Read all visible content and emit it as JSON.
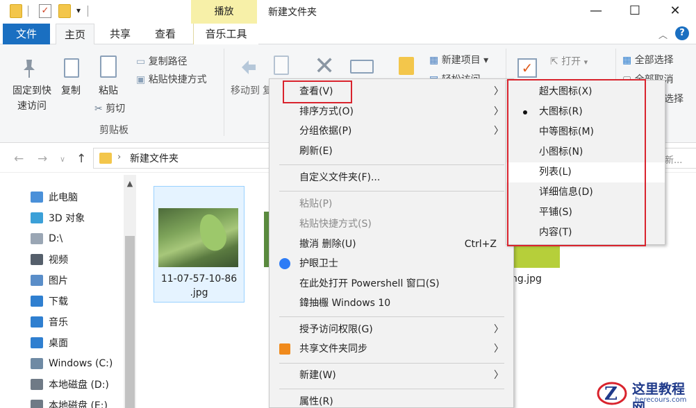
{
  "titlebar": {
    "context_tab": "播放",
    "window_title": "新建文件夹",
    "minimize_icon": "minimize-icon",
    "maximize_icon": "maximize-icon",
    "close_icon": "close-icon"
  },
  "tabs": {
    "file": "文件",
    "home": "主页",
    "share": "共享",
    "view": "查看",
    "music_tools": "音乐工具"
  },
  "ribbon": {
    "pin_quick_line1": "固定到快",
    "pin_quick_line2": "速访问",
    "copy": "复制",
    "paste": "粘贴",
    "copy_path": "复制路径",
    "paste_shortcut": "粘贴快捷方式",
    "cut": "剪切",
    "clipboard_group": "剪贴板",
    "move_to": "移动到",
    "copy_to_partial": "复",
    "new_item": "新建项目 ▾",
    "easy_access_partial": "轻松访问",
    "open": "打开",
    "open_arrow": "▾",
    "select_all": "全部选择",
    "select_none_partial": "全部取消",
    "invert_partial": "选择"
  },
  "address": {
    "back_icon": "back-arrow-icon",
    "forward_icon": "forward-arrow-icon",
    "recent_icon": "chevron-down-icon",
    "up_icon": "up-arrow-icon",
    "path": "新建文件夹",
    "search_placeholder": "新..."
  },
  "nav": {
    "items": [
      {
        "label": "此电脑",
        "icon": "computer-icon",
        "color": "#4a90d9"
      },
      {
        "label": "3D 对象",
        "icon": "3d-objects-icon",
        "color": "#3ba0d8"
      },
      {
        "label": "D:\\",
        "icon": "drive-icon",
        "color": "#9aa6b4"
      },
      {
        "label": "视频",
        "icon": "video-icon",
        "color": "#555f6b"
      },
      {
        "label": "图片",
        "icon": "pictures-icon",
        "color": "#5a8ec9"
      },
      {
        "label": "下载",
        "icon": "download-icon",
        "color": "#2f7fd0"
      },
      {
        "label": "音乐",
        "icon": "music-icon",
        "color": "#2f7fd0"
      },
      {
        "label": "桌面",
        "icon": "desktop-icon",
        "color": "#2f7fd0"
      },
      {
        "label": "Windows (C:)",
        "icon": "windows-drive-icon",
        "color": "#6f8aa4"
      },
      {
        "label": "本地磁盘 (D:)",
        "icon": "local-disk-icon",
        "color": "#6f7a86"
      },
      {
        "label": "本地磁盘 (E:)",
        "icon": "local-disk-icon",
        "color": "#6f7a86"
      }
    ]
  },
  "files": {
    "file1_line1": "11-07-57-10-86",
    "file1_line2": ".jpg",
    "file3_name": "ng.jpg"
  },
  "context_menu": {
    "view": "查看(V)",
    "sort_by": "排序方式(O)",
    "group_by": "分组依据(P)",
    "refresh": "刷新(E)",
    "customize_folder": "自定义文件夹(F)...",
    "paste": "粘贴(P)",
    "paste_shortcut": "粘贴快捷方式(S)",
    "undo_delete": "撤消 删除(U)",
    "undo_shortcut": "Ctrl+Z",
    "eye_guard": "护眼卫士",
    "open_powershell": "在此处打开 Powershell 窗口(S)",
    "garbled_item": "鍏抽棴 Windows 10",
    "grant_access": "授予访问权限(G)",
    "sync_shared": "共享文件夹同步",
    "new": "新建(W)",
    "properties": "属性(R)",
    "arrow": "〉"
  },
  "view_submenu": {
    "items": [
      {
        "label": "超大图标(X)",
        "checked": false
      },
      {
        "label": "大图标(R)",
        "checked": true
      },
      {
        "label": "中等图标(M)",
        "checked": false
      },
      {
        "label": "小图标(N)",
        "checked": false
      },
      {
        "label": "列表(L)",
        "checked": false,
        "highlighted": true
      },
      {
        "label": "详细信息(D)",
        "checked": false
      },
      {
        "label": "平铺(S)",
        "checked": false
      },
      {
        "label": "内容(T)",
        "checked": false
      }
    ]
  },
  "watermark": {
    "name": "这里教程网",
    "url": "herecours.com",
    "logo": "Z"
  },
  "colors": {
    "accent": "#1a6fc1",
    "highlight_box": "#d9232d",
    "context_tab_bg": "#f7f0a8"
  }
}
